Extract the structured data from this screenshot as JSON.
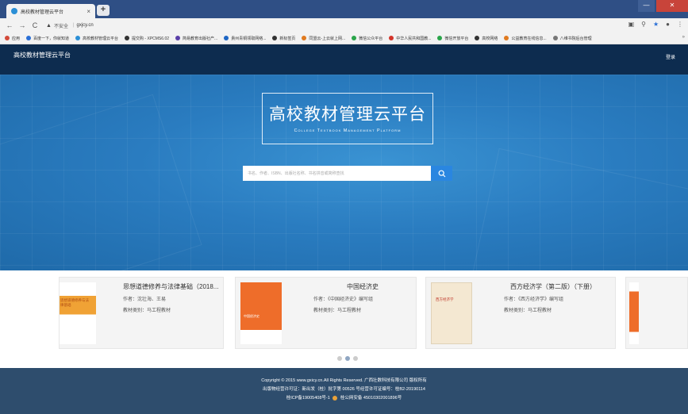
{
  "browser": {
    "tab_title": "高校教材管理云平台",
    "tab_close": "×",
    "new_tab": "+",
    "window_min": "—",
    "window_close": "✕",
    "back": "←",
    "forward": "→",
    "reload": "C",
    "insecure_label": "不安全",
    "url": "gxjcy.cn",
    "bookmarks": [
      {
        "label": "应用",
        "color": "#d34a3a"
      },
      {
        "label": "百度一下，你就知道",
        "color": "#2a6fd6"
      },
      {
        "label": "高校教材管理云平台",
        "color": "#2b8fd6"
      },
      {
        "label": "提交购 - XPCMS6.02",
        "color": "#333333"
      },
      {
        "label": "简易教育出版社产...",
        "color": "#5a3fa8"
      },
      {
        "label": "貴州青铜领取网络...",
        "color": "#1e66c4"
      },
      {
        "label": "新标签页",
        "color": "#333333"
      },
      {
        "label": "同盟云-上云就上网...",
        "color": "#e07a1f"
      },
      {
        "label": "微信公众平台",
        "color": "#2aa54a"
      },
      {
        "label": "中华人民共和国教...",
        "color": "#d3342a"
      },
      {
        "label": "微信开放平台",
        "color": "#2aa54a"
      },
      {
        "label": "高校网络",
        "color": "#333333"
      },
      {
        "label": "公益教育在线信息...",
        "color": "#e07a1f"
      },
      {
        "label": "八维书院后台管理",
        "color": "#777777"
      }
    ],
    "bookmarks_more": "»"
  },
  "site": {
    "title": "高校教材管理云平台",
    "login": "登录",
    "logo_cn": "高校教材管理云平台",
    "logo_en": "College Textbook Management Platform",
    "search_placeholder": "书名、作者、ISBN、出版社名称、书名拼音或简称查找"
  },
  "books": [
    {
      "title": "思想道德修养与法律基础（2018...",
      "author": "作者：沈壮海、王易",
      "category": "教材类别：马工程教材",
      "cover_color": "#f0a235",
      "cover_text": "思想道德修养与法律基础"
    },
    {
      "title": "中国经济史",
      "author": "作者：《中国经济史》编写组",
      "category": "教材类别：马工程教材",
      "cover_color": "#ee6d2a",
      "cover_text": "中国经济史"
    },
    {
      "title": "西方经济学（第二版）（下册）",
      "author": "作者：《西方经济学》编写组",
      "category": "教材类别：马工程教材",
      "cover_color": "#f4e8d2",
      "cover_text": "西方经济学"
    }
  ],
  "carousel": {
    "active_index": 1,
    "count": 3
  },
  "footer": {
    "line1": "Copyright © 2015 www.gxicy.cn.All Rights Reserved. 广西壮数科技有限公司 版权所有",
    "line2": "出版物经营许可证：新出发（桂）批字第 00526 号经营许可证编号：桂B2-20190114",
    "line3": "桂ICP备19005408号-1",
    "line3b": "桂公网安备 45010302001896号"
  },
  "colors": {
    "header": "#0d2c4f",
    "hero": "#2a7cc0",
    "footer": "#2e4d6d",
    "search_button": "#2a86e0"
  }
}
